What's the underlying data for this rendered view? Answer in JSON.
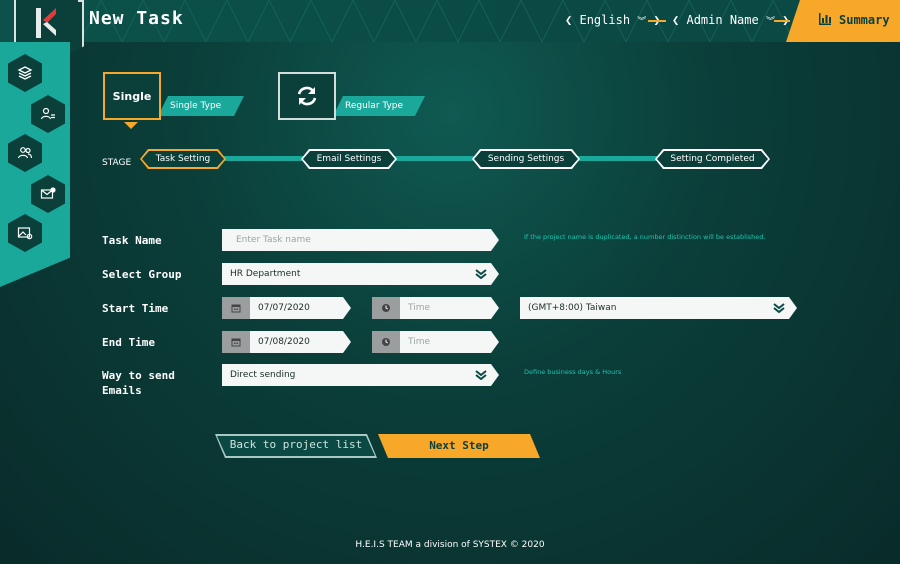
{
  "header": {
    "title": "New Task",
    "language": "English",
    "user": "Admin Name",
    "summary_label": "Summary"
  },
  "colors": {
    "accent": "#f7a828",
    "teal": "#1aa89b",
    "background": "#0b3f3a"
  },
  "sidebar": {
    "icons": [
      "layers-icon",
      "user-list-icon",
      "users-icon",
      "mail-settings-icon",
      "image-settings-icon"
    ]
  },
  "task_types": [
    {
      "card_label": "Single",
      "tag_label": "Single Type",
      "selected": true
    },
    {
      "card_label": "",
      "tag_label": "Regular Type",
      "selected": false
    }
  ],
  "stage": {
    "label": "STAGE",
    "steps": [
      "Task Setting",
      "Email Settings",
      "Sending Settings",
      "Setting Completed"
    ],
    "active_index": 0
  },
  "form": {
    "task_name": {
      "label": "Task Name",
      "placeholder": "Enter Task name",
      "value": "",
      "hint": "If the project name is duplicated, a number distinction will be established."
    },
    "select_group": {
      "label": "Select Group",
      "value": "HR Department"
    },
    "start_time": {
      "label": "Start Time",
      "date": "07/07/2020",
      "time_placeholder": "Time",
      "timezone": "(GMT+8:00) Taiwan"
    },
    "end_time": {
      "label": "End Time",
      "date": "07/08/2020",
      "time_placeholder": "Time"
    },
    "send_way": {
      "label_line1": "Way to send",
      "label_line2": "Emails",
      "value": "Direct sending",
      "hint": "Define business days & Hours"
    }
  },
  "actions": {
    "back_label": "Back to project list",
    "next_label": "Next Step"
  },
  "footer": {
    "text": "H.E.I.S TEAM a division of SYSTEX © 2020"
  }
}
